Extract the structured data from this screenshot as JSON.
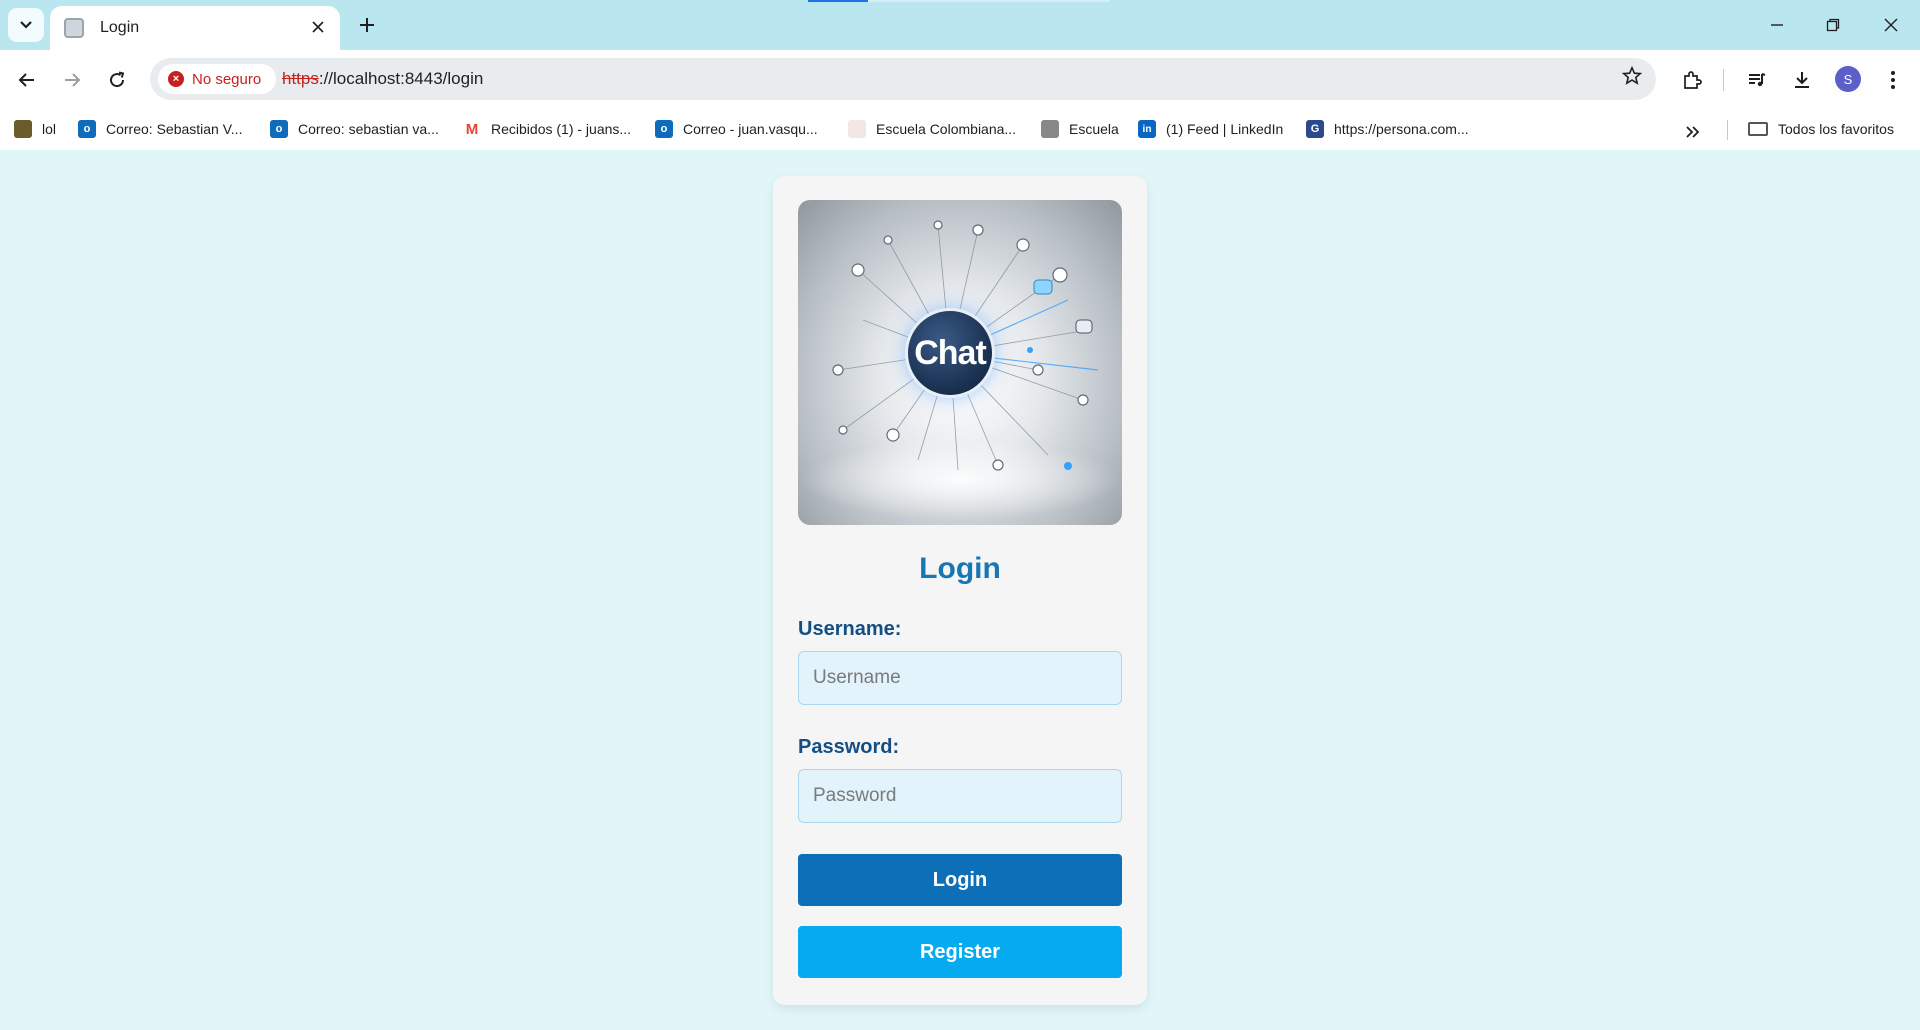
{
  "browser": {
    "tab": {
      "title": "Login"
    },
    "security_label": "No seguro",
    "url": {
      "scheme": "https",
      "rest": "://localhost:8443/login"
    },
    "profile_initial": "S",
    "bookmarks": [
      {
        "label": "lol",
        "icon": "lol-icon",
        "color": "#6b5a2a"
      },
      {
        "label": "Correo: Sebastian V...",
        "icon": "outlook-icon",
        "color": "#0f6cbd"
      },
      {
        "label": "Correo: sebastian va...",
        "icon": "outlook-icon",
        "color": "#0f6cbd"
      },
      {
        "label": "Recibidos (1) - juans...",
        "icon": "gmail-icon",
        "color": "#ea4335"
      },
      {
        "label": "Correo - juan.vasqu...",
        "icon": "outlook-icon",
        "color": "#0f6cbd"
      },
      {
        "label": "Escuela Colombiana...",
        "icon": "escuela-logo-icon",
        "color": "#b03030"
      },
      {
        "label": "Escuela",
        "icon": "escuela-icon",
        "color": "#666666"
      },
      {
        "label": "(1) Feed | LinkedIn",
        "icon": "linkedin-icon",
        "color": "#0a66c2"
      },
      {
        "label": "https://persona.com...",
        "icon": "persona-icon",
        "color": "#2b4a8c"
      }
    ],
    "all_bookmarks_label": "Todos los favoritos"
  },
  "page": {
    "hero_text": "Chat",
    "title": "Login",
    "username_label": "Username:",
    "username_placeholder": "Username",
    "password_label": "Password:",
    "password_placeholder": "Password",
    "login_button": "Login",
    "register_button": "Register"
  },
  "colors": {
    "page_background": "#e1f6f8",
    "title": "#1677b5",
    "label": "#134f83",
    "login_button": "#0d6fb8",
    "register_button": "#05aaf0"
  }
}
